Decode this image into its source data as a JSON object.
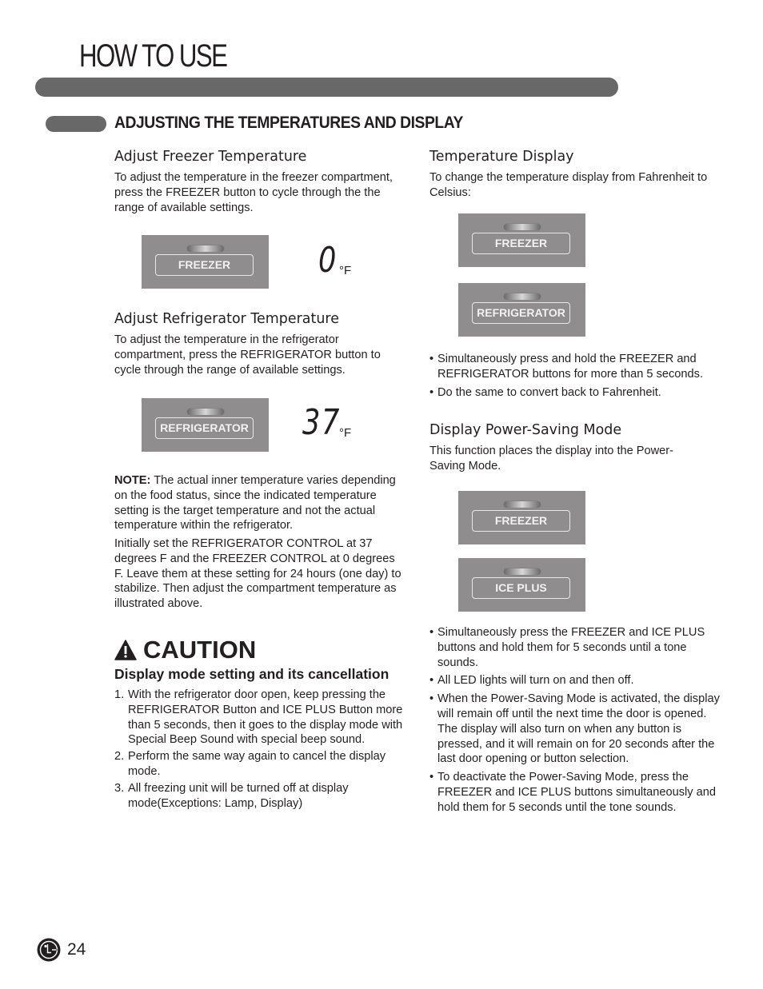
{
  "header": {
    "title": "HOW TO USE"
  },
  "section": {
    "heading": "ADJUSTING THE TEMPERATURES AND DISPLAY"
  },
  "freezer_temp": {
    "heading": "Adjust Freezer Temperature",
    "body": "To adjust the temperature in the freezer compartment, press the FREEZER button to cycle through the the range of available settings.",
    "button_label": "FREEZER",
    "display_value": "0",
    "display_unit": "°F"
  },
  "fridge_temp": {
    "heading": "Adjust Refrigerator Temperature",
    "body": "To adjust the temperature in the refrigerator compartment, press the REFRIGERATOR button to cycle through the range of available settings.",
    "button_label": "REFRIGERATOR",
    "display_value": "37",
    "display_unit": "°F"
  },
  "note": {
    "label": "NOTE:",
    "text": " The actual inner temperature varies depending on the food status, since the indicated temperature setting is the target temperature and not the actual temperature within the refrigerator.",
    "initial_setting": "Initially set the REFRIGERATOR CONTROL at 37 degrees F and the FREEZER CONTROL at 0 degrees F. Leave them at these setting for 24 hours (one day) to stabilize. Then adjust the compartment temperature as illustrated above."
  },
  "caution": {
    "title": "CAUTION",
    "icon": "warning-triangle-icon",
    "subheading": "Display mode setting and its cancellation",
    "items": [
      {
        "num": "1.",
        "text": "With the refrigerator door open, keep pressing the REFRIGERATOR Button and ICE PLUS Button more than 5 seconds, then it goes to the display mode with Special Beep Sound with special beep sound."
      },
      {
        "num": "2.",
        "text": "Perform the same way again to cancel the display mode."
      },
      {
        "num": "3.",
        "text": "All freezing unit will be turned off at display mode(Exceptions: Lamp, Display)"
      }
    ]
  },
  "temp_display": {
    "heading": "Temperature Display",
    "body": "To change the temperature display from Fahrenheit to Celsius:",
    "buttons": [
      "FREEZER",
      "REFRIGERATOR"
    ],
    "bullets": [
      "Simultaneously press and hold the FREEZER and REFRIGERATOR buttons for more than 5 seconds.",
      "Do the same to convert back to Fahrenheit."
    ]
  },
  "power_saving": {
    "heading": "Display Power-Saving Mode",
    "body": "This function places the display into the Power-Saving Mode.",
    "buttons": [
      "FREEZER",
      "ICE PLUS"
    ],
    "bullets": [
      "Simultaneously press the FREEZER and ICE PLUS buttons and hold them for 5 seconds until a tone sounds.",
      "All LED lights will turn on and then off.",
      "When the Power-Saving Mode is activated, the display will remain off until the next time the door is opened. The display will also turn on when any button is pressed, and it will remain on for 20 seconds after the last door opening or button selection.",
      "To deactivate the Power-Saving Mode, press the FREEZER and ICE PLUS buttons simultaneously and hold them for 5 seconds until the tone sounds."
    ]
  },
  "footer": {
    "logo": "lg-logo-icon",
    "page_number": "24"
  }
}
